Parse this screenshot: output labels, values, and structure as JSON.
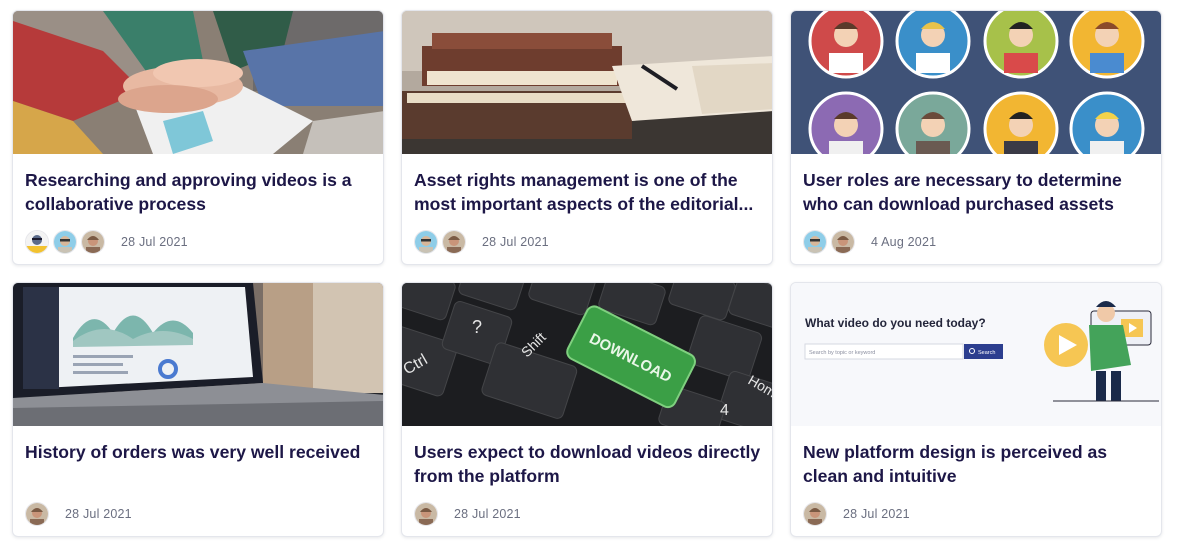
{
  "cards": [
    {
      "title": "Researching and approving videos is a collaborative process",
      "date": "28 Jul 2021",
      "thumbnail": "team-hands-photo",
      "avatars": [
        "avatar-yellow-beard",
        "avatar-sunglasses",
        "avatar-brown-hair"
      ]
    },
    {
      "title": "Asset rights management is one of the most important aspects of the editorial...",
      "date": "28 Jul 2021",
      "thumbnail": "books-and-notebook-photo",
      "avatars": [
        "avatar-sunglasses",
        "avatar-brown-hair"
      ]
    },
    {
      "title": "User roles are necessary to determine who can download purchased assets",
      "date": "4 Aug 2021",
      "thumbnail": "user-avatars-illustration",
      "avatars": [
        "avatar-sunglasses",
        "avatar-brown-hair"
      ]
    },
    {
      "title": "History of orders was very well received",
      "date": "28 Jul 2021",
      "thumbnail": "laptop-dashboard-photo",
      "avatars": [
        "avatar-brown-hair"
      ]
    },
    {
      "title": "Users expect to download videos directly from the platform",
      "date": "28 Jul 2021",
      "thumbnail": "keyboard-download-key-photo",
      "avatars": [
        "avatar-brown-hair"
      ]
    },
    {
      "title": "New platform design is perceived as clean and intuitive",
      "date": "28 Jul 2021",
      "thumbnail": "platform-search-screen-illustration",
      "avatars": [
        "avatar-brown-hair"
      ]
    }
  ],
  "keyboard": {
    "download_key": "DOWNLOAD",
    "shift_key": "Shift",
    "ctrl_key": "Ctrl",
    "home_key": "Hom",
    "number_key": "4",
    "question_key": "?"
  },
  "platform_preview": {
    "heading": "What video do you need today?",
    "search_placeholder": "Search by topic or keyword",
    "search_button": "Search"
  },
  "colors": {
    "title": "#1d1747",
    "date": "#6b6f80",
    "illustration_bg": "#3f5277",
    "search_button": "#2c3e8f",
    "download_key": "#3b9f46"
  }
}
